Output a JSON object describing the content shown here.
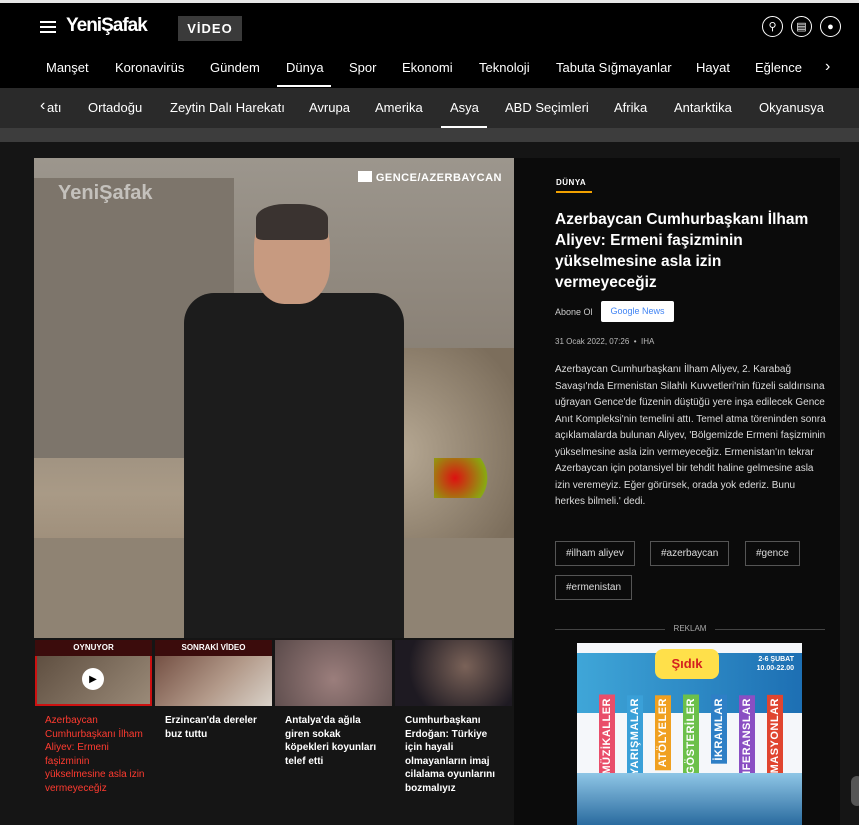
{
  "header": {
    "logo": "YeniŞafak",
    "section_badge": "VİDEO",
    "icons": [
      "search-icon",
      "newspaper-icon",
      "user-icon"
    ]
  },
  "nav_primary": {
    "items": [
      "Manşet",
      "Koronavirüs",
      "Gündem",
      "Dünya",
      "Spor",
      "Ekonomi",
      "Teknoloji",
      "Tabuta Sığmayanlar",
      "Hayat",
      "Eğlence"
    ],
    "active": "Dünya"
  },
  "nav_secondary": {
    "items": [
      "atı",
      "Ortadoğu",
      "Zeytin Dalı Harekatı",
      "Avrupa",
      "Amerika",
      "Asya",
      "ABD Seçimleri",
      "Afrika",
      "Antarktika",
      "Okyanusya"
    ],
    "active": "Asya"
  },
  "player": {
    "watermark": "YeniŞafak",
    "location": "GENCE/AZERBAYCAN"
  },
  "playlist": [
    {
      "tag": "OYNUYOR",
      "title": "Azerbaycan Cumhurbaşkanı İlham Aliyev: Ermeni faşizminin yükselmesine asla izin vermeyeceğiz",
      "active": true
    },
    {
      "tag": "SONRAKİ VİDEO",
      "title": "Erzincan'da dereler buz tuttu",
      "active": false
    },
    {
      "tag": "",
      "title": "Antalya'da ağıla giren sokak köpekleri koyunları telef etti",
      "active": false
    },
    {
      "tag": "",
      "title": "Cumhurbaşkanı Erdoğan: Türkiye için hayali olmayanların imaj cilalama oyunlarını bozmalıyız",
      "active": false
    }
  ],
  "article": {
    "category": "DÜNYA",
    "title": "Azerbaycan Cumhurbaşkanı İlham Aliyev: Ermeni faşizminin yükselmesine asla izin vermeyeceğiz",
    "subscribe_label": "Abone Ol",
    "google_news": "Google News",
    "date": "31 Ocak 2022, 07:26",
    "source": "IHA",
    "body": "Azerbaycan Cumhurbaşkanı İlham Aliyev, 2. Karabağ Savaşı'nda Ermenistan Silahlı Kuvvetleri'nin füzeli saldırısına uğrayan Gence'de füzenin düştüğü yere inşa edilecek Gence Anıt Kompleksi'nin temelini attı. Temel atma töreninden sonra açıklamalarda bulunan Aliyev, 'Bölgemizde Ermeni faşizminin yükselmesine asla izin vermeyeceğiz. Ermenistan'ın tekrar Azerbaycan için potansiyel bir tehdit haline gelmesine asla izin veremeyiz. Eğer görürsek, orada yok ederiz. Bunu herkes bilmeli.' dedi.",
    "tags": [
      "#ilham aliyev",
      "#azerbaycan",
      "#gence",
      "#ermenistan"
    ]
  },
  "ad": {
    "label": "REKLAM",
    "brand": "Şıdık",
    "dates": "2-6 ŞUBAT\n10.00-22.00",
    "columns": [
      "MÜZİKALLER",
      "YARIŞMALAR",
      "ATÖLYELER",
      "GÖSTERİLER",
      "İKRAMLAR",
      "KONFERANSLAR",
      "ANİMASYONLAR"
    ]
  }
}
